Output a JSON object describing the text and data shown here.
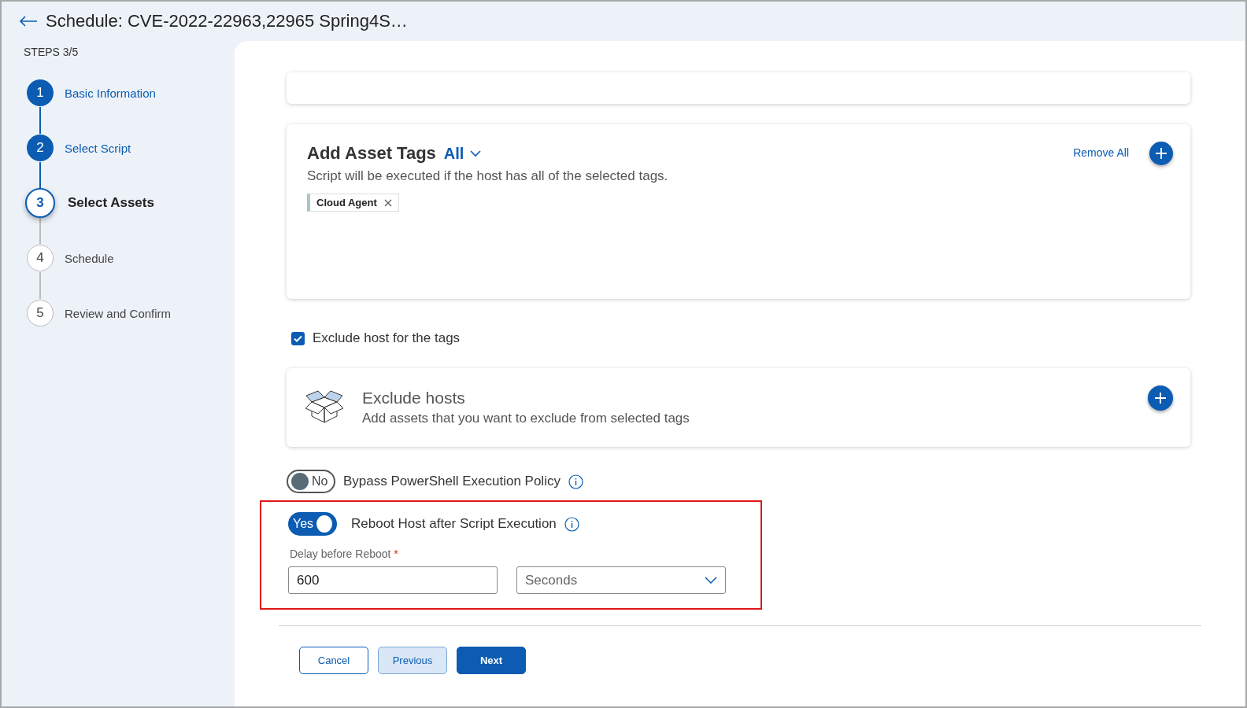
{
  "header": {
    "title": "Schedule: CVE-2022-22963,22965 Spring4S…"
  },
  "steps": {
    "counter": "STEPS 3/5",
    "items": [
      {
        "number": "1",
        "label": "Basic Information",
        "done": true,
        "selected": false
      },
      {
        "number": "2",
        "label": "Select Script",
        "done": true,
        "selected": false
      },
      {
        "number": "3",
        "label": "Select Assets",
        "done": false,
        "selected": true
      },
      {
        "number": "4",
        "label": "Schedule",
        "done": false,
        "selected": false
      },
      {
        "number": "5",
        "label": "Review and Confirm",
        "done": false,
        "selected": false
      }
    ]
  },
  "asset_tags": {
    "title": "Add Asset Tags",
    "match": "All",
    "description": "Script will be executed if the host has all of the selected tags.",
    "remove_all": "Remove All",
    "tags": [
      {
        "label": "Cloud Agent"
      }
    ]
  },
  "exclude_for_tags": {
    "label": "Exclude host for the tags",
    "checked": true
  },
  "exclude_hosts": {
    "title": "Exclude hosts",
    "description": "Add assets that you want to exclude from selected tags"
  },
  "toggles": [
    {
      "state": "No",
      "label": "Bypass PowerShell Execution Policy",
      "on": false
    },
    {
      "state": "Yes",
      "label": "Reboot Host after Script Execution",
      "on": true
    }
  ],
  "delay": {
    "label": "Delay before Reboot",
    "required_mark": "*",
    "value": "600",
    "unit": "Seconds"
  },
  "buttons": [
    {
      "label": "Cancel",
      "kind": "outline"
    },
    {
      "label": "Previous",
      "kind": "soft"
    },
    {
      "label": "Next",
      "kind": "primary"
    }
  ]
}
